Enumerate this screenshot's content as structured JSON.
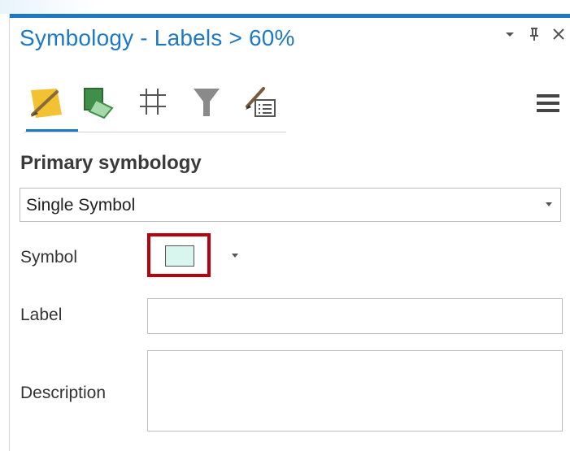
{
  "pane": {
    "title": "Symbology - Labels > 60%",
    "accent_color": "#1d79c6",
    "controls": {
      "dropdown_icon": "chevron-down-icon",
      "pin_icon": "pin-icon",
      "close_icon": "close-icon"
    }
  },
  "tabs": [
    {
      "icon": "primary-symbology-icon",
      "active": true
    },
    {
      "icon": "vary-symbology-icon",
      "active": false
    },
    {
      "icon": "label-placement-icon",
      "active": false
    },
    {
      "icon": "filter-icon",
      "active": false
    },
    {
      "icon": "symbol-properties-icon",
      "active": false
    }
  ],
  "menu_icon": "hamburger-menu-icon",
  "primary_symbology": {
    "heading": "Primary symbology",
    "selected": "Single Symbol"
  },
  "fields": {
    "symbol_label": "Symbol",
    "symbol_swatch_color": "#d8f5ee",
    "symbol_highlight_color": "#b8000f",
    "label_label": "Label",
    "label_value": "",
    "description_label": "Description",
    "description_value": ""
  }
}
